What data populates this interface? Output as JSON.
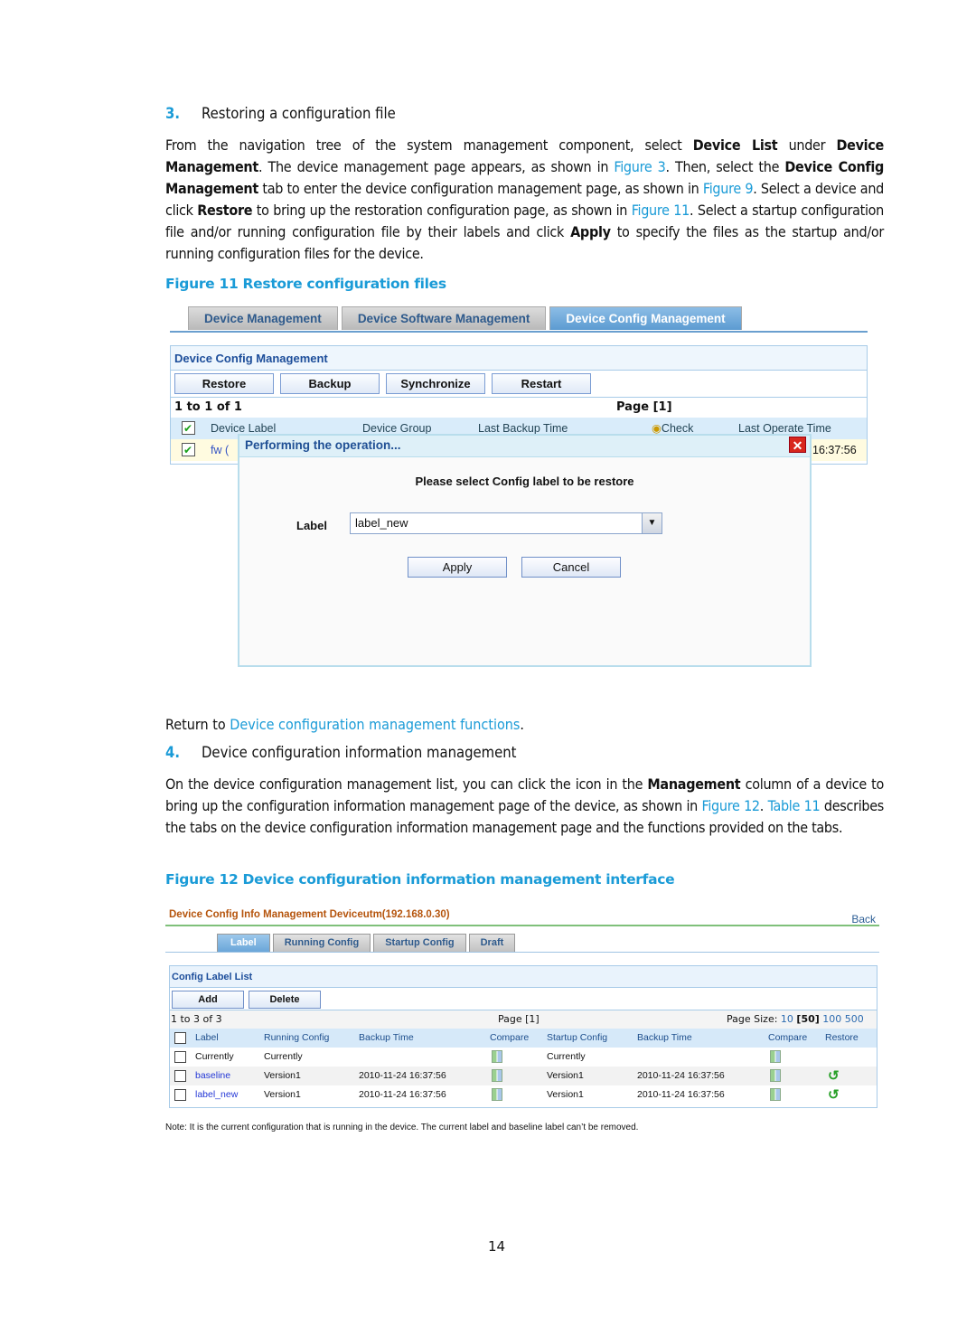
{
  "section3": {
    "number": "3.",
    "title": "Restoring a configuration file",
    "paragraph": [
      {
        "t": "From the navigation tree of the system management component, select "
      },
      {
        "b": "Device List"
      },
      {
        "t": " under "
      },
      {
        "b": "Device Management"
      },
      {
        "t": ". The device management page appears, as shown in "
      },
      {
        "l": "Figure 3"
      },
      {
        "t": ". Then, select the "
      },
      {
        "b": "Device Config Management"
      },
      {
        "t": " tab to enter the device configuration management page, as shown in "
      },
      {
        "l": "Figure 9"
      },
      {
        "t": ". Select a device and click "
      },
      {
        "b": "Restore"
      },
      {
        "t": " to bring up the restoration configuration page, as shown in "
      },
      {
        "l": "Figure 11"
      },
      {
        "t": ". Select a startup configuration file and/or running configuration file by their labels and click "
      },
      {
        "b": "Apply"
      },
      {
        "t": " to specify the files as the startup and/or running configuration files for the device."
      }
    ]
  },
  "figure11": {
    "caption": "Figure 11 Restore configuration files",
    "tabs": [
      "Device Management",
      "Device Software Management",
      "Device Config Management"
    ],
    "active_tab": 2,
    "panel_title": "Device Config Management",
    "buttons": [
      "Restore",
      "Backup",
      "Synchronize",
      "Restart"
    ],
    "range": "1 to 1 of 1",
    "page": "Page [1]",
    "columns": [
      "Device Label",
      "Device Group",
      "Last Backup Time",
      "Check",
      "Last Operate Time"
    ],
    "row": {
      "label": "fw (",
      "last_operate": "16:37:56"
    },
    "dialog": {
      "title": "Performing the operation...",
      "close": "✕",
      "prompt": "Please select Config label to be restore",
      "field_label": "Label",
      "selected_value": "label_new",
      "apply": "Apply",
      "cancel": "Cancel"
    }
  },
  "return_line": {
    "prefix": "Return to ",
    "link": "Device configuration management functions",
    "suffix": "."
  },
  "section4": {
    "number": "4.",
    "title": "Device configuration information management",
    "paragraph": [
      {
        "t": "On the device configuration management list, you can click the icon in the "
      },
      {
        "b": "Management"
      },
      {
        "t": " column of a device to bring up the configuration information management page of the device, as shown in "
      },
      {
        "l": "Figure 12"
      },
      {
        "t": ". "
      },
      {
        "l": "Table 11"
      },
      {
        "t": " describes the tabs on the device configuration information management page and the functions provided on the tabs."
      }
    ]
  },
  "figure12": {
    "caption": "Figure 12 Device configuration information management interface",
    "title": "Device Config Info Management Deviceutm(192.168.0.30)",
    "back": "Back",
    "tabs": [
      "Label",
      "Running Config",
      "Startup Config",
      "Draft"
    ],
    "active_tab": 0,
    "panel_title": "Config Label List",
    "buttons": [
      "Add",
      "Delete"
    ],
    "range": "1 to 3 of 3",
    "page": "Page [1]",
    "page_size_label": "Page Size:",
    "page_sizes": [
      "10",
      "[50]",
      "100",
      "500"
    ],
    "columns": [
      "Label",
      "Running Config",
      "Backup Time",
      "Compare",
      "Startup Config",
      "Backup Time",
      "Compare",
      "Restore"
    ],
    "rows": [
      {
        "label": "Currently",
        "running": "Currently",
        "run_time": "",
        "startup": "Currently",
        "start_time": "",
        "restore": false,
        "link": false
      },
      {
        "label": "baseline",
        "running": "Version1",
        "run_time": "2010-11-24 16:37:56",
        "startup": "Version1",
        "start_time": "2010-11-24 16:37:56",
        "restore": true,
        "link": true
      },
      {
        "label": "label_new",
        "running": "Version1",
        "run_time": "2010-11-24 16:37:56",
        "startup": "Version1",
        "start_time": "2010-11-24 16:37:56",
        "restore": true,
        "link": true
      }
    ],
    "note": "Note: It is the current configuration that is running in the device. The current label and baseline label can’t be removed."
  },
  "page_number": "14"
}
